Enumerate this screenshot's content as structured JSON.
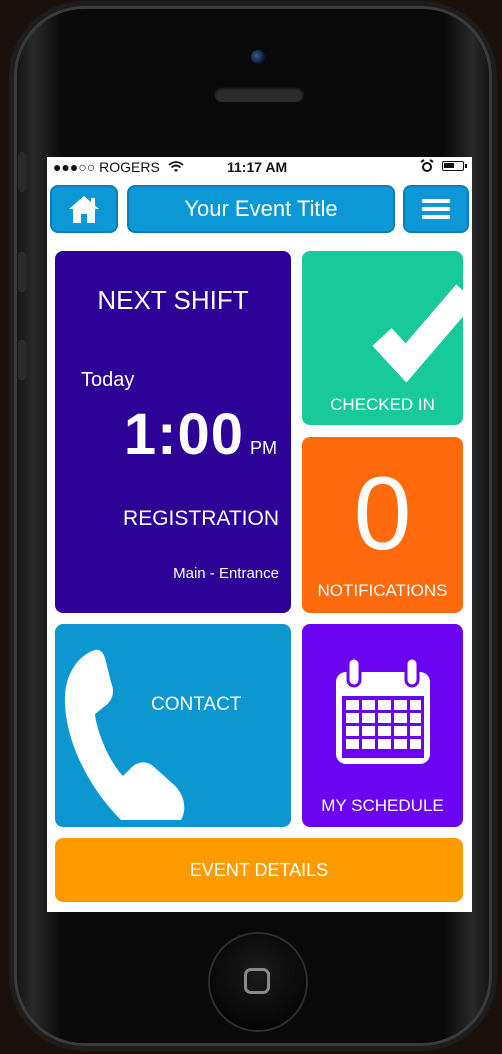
{
  "status": {
    "carrier": "●●●○○ ROGERS",
    "time": "11:17 AM"
  },
  "header": {
    "title": "Your Event Title",
    "home_icon": "home-icon",
    "menu_icon": "hamburger-menu-icon"
  },
  "next_shift": {
    "heading": "NEXT SHIFT",
    "day": "Today",
    "time": "1:00",
    "ampm": "PM",
    "role": "REGISTRATION",
    "location": "Main - Entrance"
  },
  "checked_in": {
    "label": "CHECKED IN",
    "icon": "checkmark-icon"
  },
  "notifications": {
    "count": "0",
    "label": "NOTIFICATIONS"
  },
  "contact": {
    "label": "CONTACT",
    "icon": "phone-icon"
  },
  "schedule": {
    "label": "MY SCHEDULE",
    "icon": "calendar-icon"
  },
  "event_details": {
    "label": "EVENT DETAILS"
  },
  "colors": {
    "nav_blue": "#0c98d6",
    "shift_purple": "#2c0297",
    "checked_green": "#18c99a",
    "notif_orange": "#ff6b0c",
    "contact_blue": "#0c97d0",
    "schedule_violet": "#6b04f0",
    "details_orange": "#ff9a00"
  }
}
